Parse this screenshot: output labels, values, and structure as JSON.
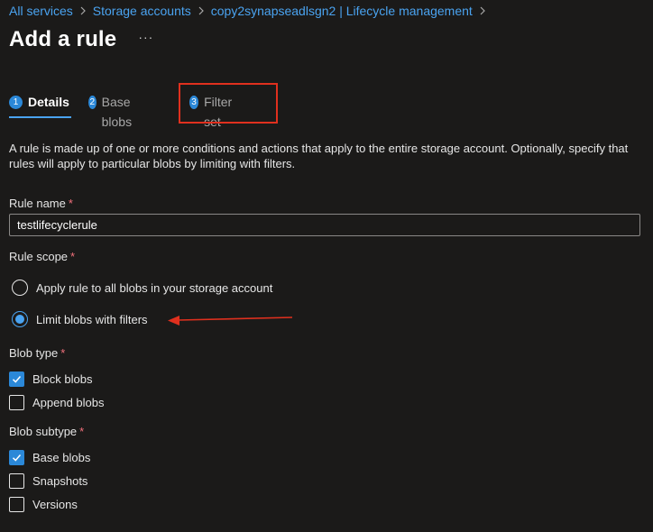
{
  "breadcrumb": {
    "items": [
      "All services",
      "Storage accounts",
      "copy2synapseadlsgn2 | Lifecycle management"
    ]
  },
  "header": {
    "title": "Add a rule",
    "more_label": "···"
  },
  "tabs": [
    {
      "number": "1",
      "label": "Details",
      "active": true
    },
    {
      "number": "2",
      "label": "Base blobs",
      "active": false
    },
    {
      "number": "3",
      "label": "Filter set",
      "active": false
    }
  ],
  "description": "A rule is made up of one or more conditions and actions that apply to the entire storage account. Optionally, specify that rules will apply to particular blobs by limiting with filters.",
  "rule_name": {
    "label": "Rule name",
    "required_marker": "*",
    "value": "testlifecyclerule"
  },
  "rule_scope": {
    "label": "Rule scope",
    "required_marker": "*",
    "options": [
      {
        "label": "Apply rule to all blobs in your storage account",
        "selected": false
      },
      {
        "label": "Limit blobs with filters",
        "selected": true
      }
    ]
  },
  "blob_type": {
    "label": "Blob type",
    "required_marker": "*",
    "options": [
      {
        "label": "Block blobs",
        "checked": true
      },
      {
        "label": "Append blobs",
        "checked": false
      }
    ]
  },
  "blob_subtype": {
    "label": "Blob subtype",
    "required_marker": "*",
    "options": [
      {
        "label": "Base blobs",
        "checked": true
      },
      {
        "label": "Snapshots",
        "checked": false
      },
      {
        "label": "Versions",
        "checked": false
      }
    ]
  },
  "colors": {
    "accent": "#2b88d8",
    "link": "#4aa3f0",
    "annotation": "#e0301e",
    "required": "#f1707b",
    "background": "#1b1a19"
  }
}
